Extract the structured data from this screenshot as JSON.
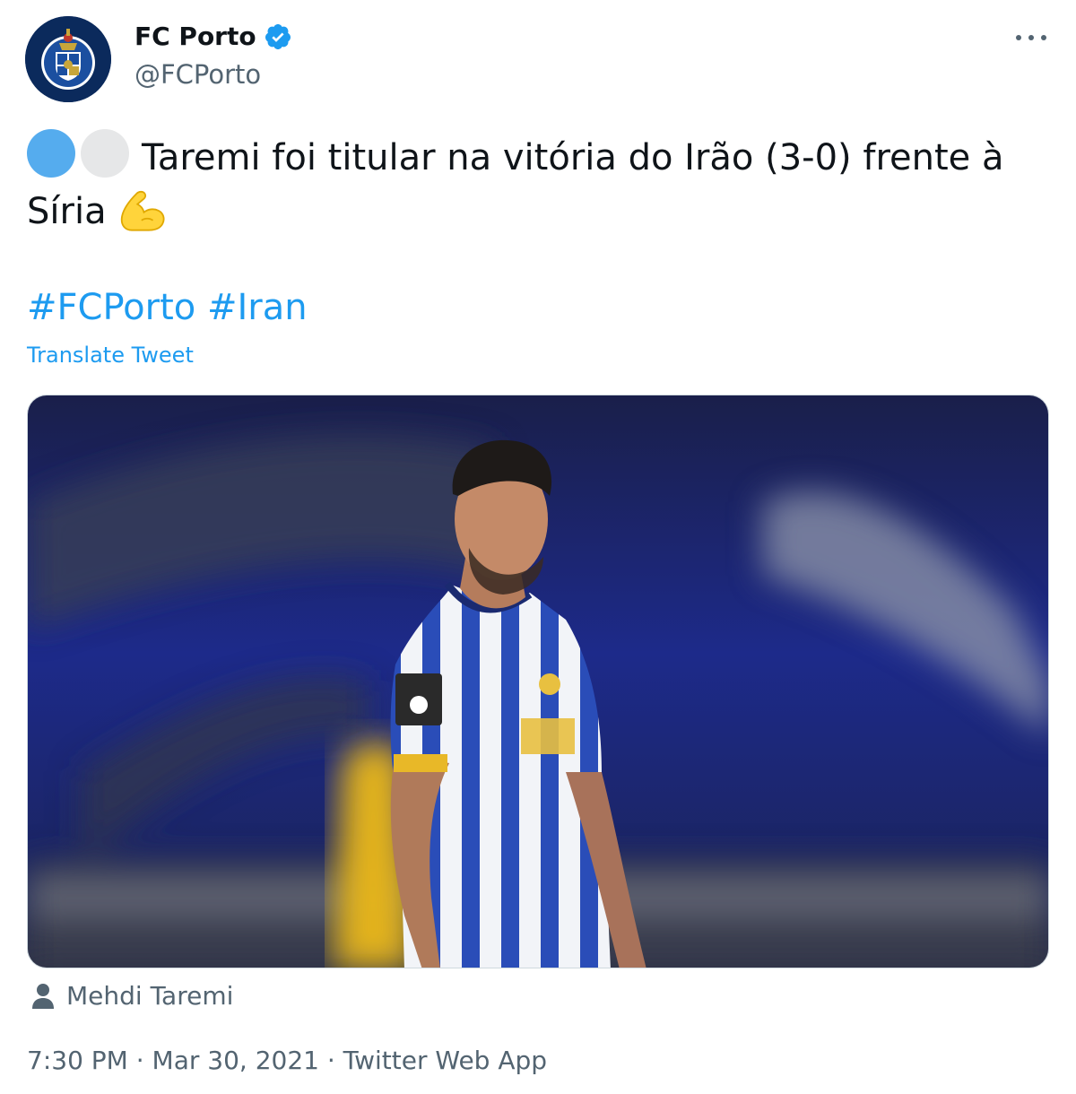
{
  "author": {
    "display_name": "FC Porto",
    "handle": "@FCPorto",
    "verified": true,
    "avatar_icon": "fc-porto-crest-icon"
  },
  "more_icon": "more-horizontal-icon",
  "tweet": {
    "text": "Taremi foi titular na vitória do Irão (3-0) frente à Síria",
    "flags": [
      {
        "name": "flag-circle-blue",
        "color": "#55acee"
      },
      {
        "name": "flag-circle-white",
        "color": "#e6e7e8"
      }
    ],
    "emoji": "flexed-biceps-icon",
    "hashtags": [
      "#FCPorto",
      "#Iran"
    ],
    "translate_label": "Translate Tweet"
  },
  "media": {
    "tagged_person": "Mehdi Taremi",
    "tag_icon": "person-icon"
  },
  "meta": {
    "time": "7:30 PM",
    "separator": " · ",
    "date": "Mar 30, 2021",
    "source": "Twitter Web App"
  },
  "colors": {
    "link": "#1d9bf0",
    "secondary_text": "#536471",
    "verified": "#1d9bf0"
  }
}
